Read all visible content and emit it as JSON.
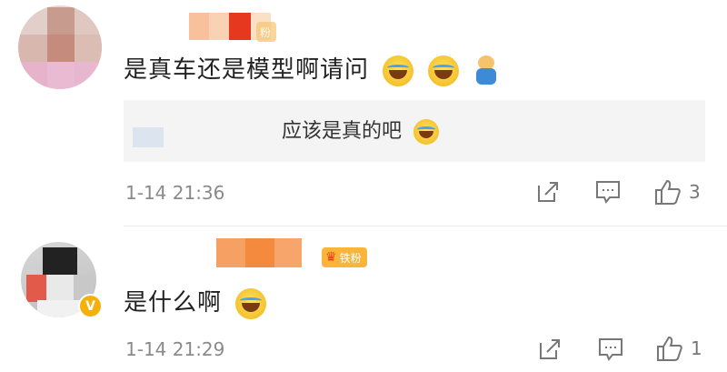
{
  "comments": [
    {
      "text": "是真车还是模型啊请问",
      "fan_badge": "粉",
      "reply": {
        "text": "应该是真的吧"
      },
      "time": "1-14 21:36",
      "likes": "3",
      "emojis": [
        "laugh-cry-emoji",
        "laugh-cry-emoji",
        "cheer-sticker"
      ]
    },
    {
      "text": "是什么啊",
      "fan_badge": "铁粉",
      "verified_mark": "V",
      "time": "1-14 21:29",
      "likes": "1",
      "emojis": [
        "laugh-cry-emoji"
      ]
    }
  ],
  "icons": {
    "share": "share-icon",
    "comment": "comment-icon",
    "like": "thumbs-up-icon"
  },
  "colors": {
    "username_mosaic": [
      "#f8c19b",
      "#f49a5f",
      "#e6381f",
      "#fbc59a"
    ],
    "fan_badge": "#f9b43a",
    "verified": "#f5b00b"
  }
}
